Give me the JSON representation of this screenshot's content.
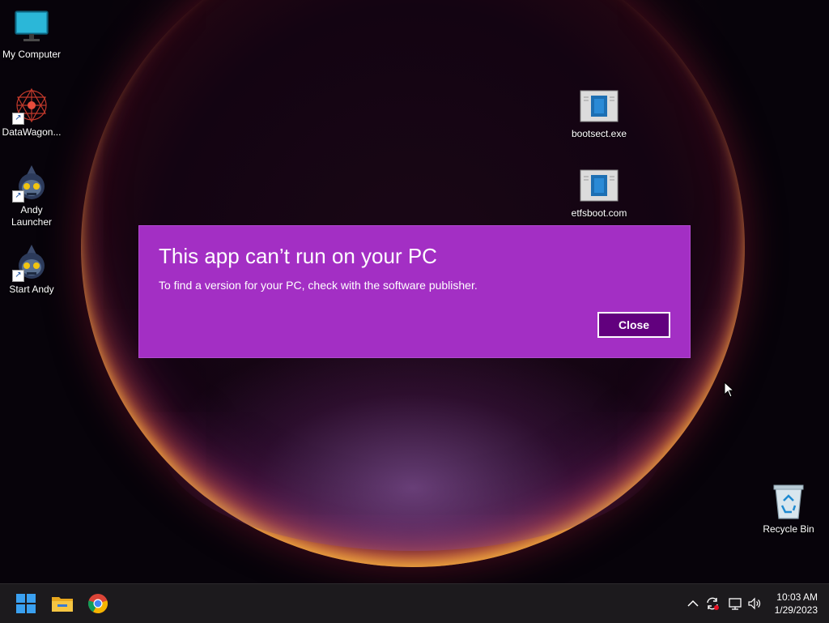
{
  "desktop": {
    "icons": [
      {
        "label": "My Computer",
        "icon": "monitor-icon"
      },
      {
        "label": "DataWagon...",
        "icon": "datawagon-icon"
      },
      {
        "label": "Andy Launcher",
        "icon": "andy-icon"
      },
      {
        "label": "Start Andy",
        "icon": "andy-icon"
      },
      {
        "label": "bootsect.exe",
        "icon": "executable-icon"
      },
      {
        "label": "etfsboot.com",
        "icon": "executable-icon"
      },
      {
        "label": "Recycle Bin",
        "icon": "recycle-bin-icon"
      }
    ]
  },
  "dialog": {
    "title": "This app can’t run on your PC",
    "message": "To find a version for your PC, check with the software publisher.",
    "close_label": "Close",
    "background": "#a32fc4",
    "button_color": "#62007e"
  },
  "taskbar": {
    "apps": [
      {
        "name": "Start",
        "icon": "windows-start-icon"
      },
      {
        "name": "File Explorer",
        "icon": "folder-icon"
      },
      {
        "name": "Google Chrome",
        "icon": "chrome-icon"
      }
    ],
    "tray": [
      "chevron-up-icon",
      "sync-icon",
      "network-icon",
      "volume-icon"
    ],
    "time": "10:03 AM",
    "date": "1/29/2023"
  }
}
